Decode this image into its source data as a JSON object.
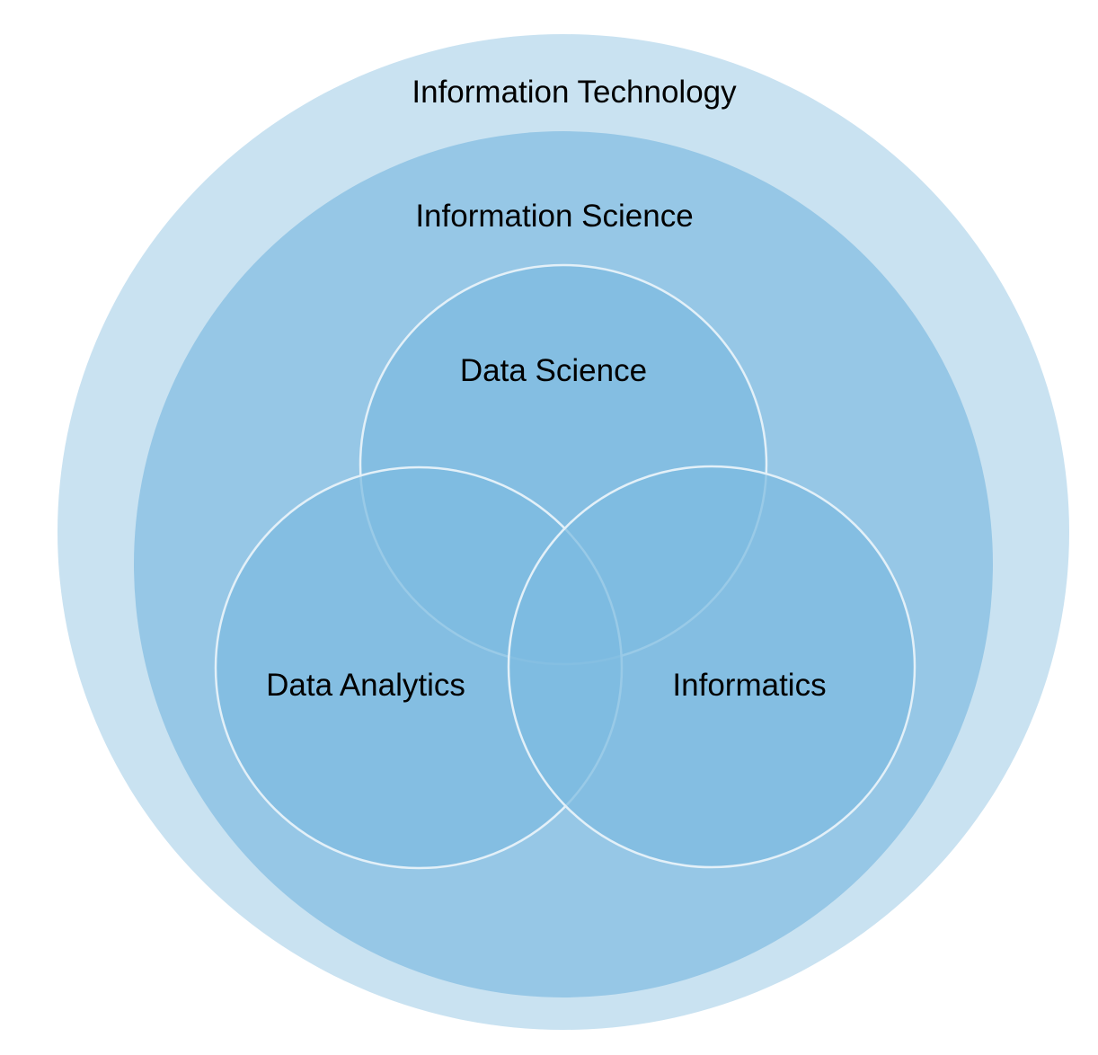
{
  "diagram": {
    "type": "nested-venn",
    "outer_label": "Information Technology",
    "inner_label": "Information Science",
    "venn": {
      "top_label": "Data Science",
      "left_label": "Data Analytics",
      "right_label": "Informatics"
    }
  },
  "colors": {
    "outer_fill": "#c9e2f1",
    "inner_fill": "#96c7e6",
    "venn_fill": "#7dbbe1",
    "venn_stroke": "#e3f0f8",
    "text": "#000000"
  }
}
